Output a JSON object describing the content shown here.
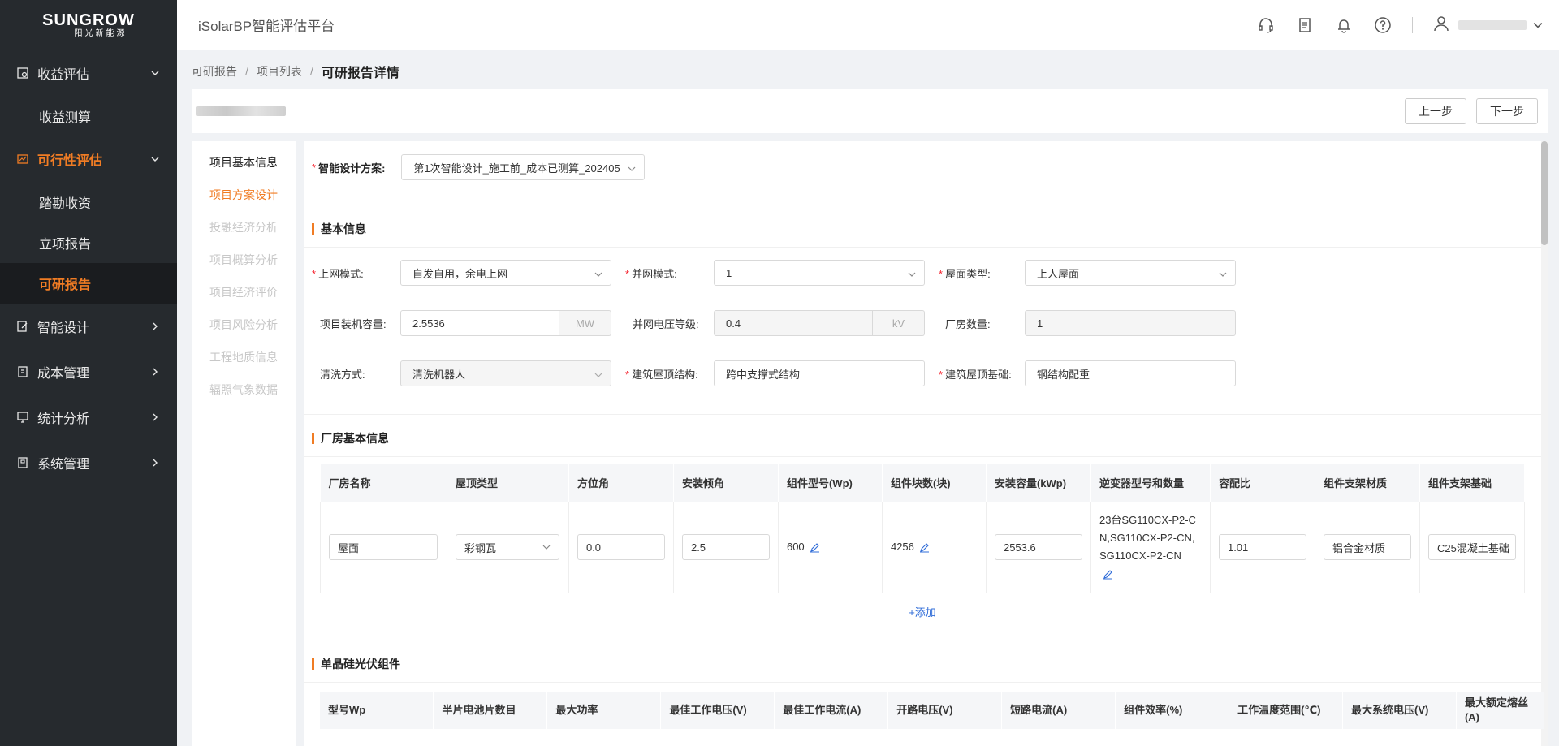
{
  "logo": {
    "brand": "SUNGROW",
    "sub": "阳光新能源"
  },
  "app_title": "iSolarBP智能评估平台",
  "sidebar": {
    "groups": [
      {
        "label": "收益评估",
        "expanded": true,
        "items": [
          "收益测算"
        ]
      },
      {
        "label": "可行性评估",
        "expanded": true,
        "active": true,
        "items": [
          "踏勘收资",
          "立项报告",
          "可研报告"
        ]
      },
      {
        "label": "智能设计"
      },
      {
        "label": "成本管理"
      },
      {
        "label": "统计分析"
      },
      {
        "label": "系统管理"
      }
    ]
  },
  "breadcrumb": {
    "items": [
      "可研报告",
      "项目列表"
    ],
    "current": "可研报告详情",
    "sep": "/"
  },
  "toolbar": {
    "prev_label": "上一步",
    "next_label": "下一步"
  },
  "steps": [
    "项目基本信息",
    "项目方案设计",
    "投融经济分析",
    "项目概算分析",
    "项目经济评价",
    "项目风险分析",
    "工程地质信息",
    "辐照气象数据"
  ],
  "design": {
    "label": "智能设计方案:",
    "value": "第1次智能设计_施工前_成本已测算_202405"
  },
  "basic": {
    "title": "基本信息",
    "grid_mode_label": "上网模式:",
    "grid_mode_value": "自发自用，余电上网",
    "parallel_label": "并网模式:",
    "parallel_value": "1",
    "roof_type_label": "屋面类型:",
    "roof_type_value": "上人屋面",
    "capacity_label": "项目装机容量:",
    "capacity_value": "2.5536",
    "capacity_unit": "MW",
    "voltage_label": "并网电压等级:",
    "voltage_value": "0.4",
    "voltage_unit": "kV",
    "plant_count_label": "厂房数量:",
    "plant_count_value": "1",
    "clean_label": "清洗方式:",
    "clean_value": "清洗机器人",
    "roof_struct_label": "建筑屋顶结构:",
    "roof_struct_value": "跨中支撑式结构",
    "roof_base_label": "建筑屋顶基础:",
    "roof_base_value": "钢结构配重"
  },
  "plant": {
    "title": "厂房基本信息",
    "columns": [
      "厂房名称",
      "屋顶类型",
      "方位角",
      "安装倾角",
      "组件型号(Wp)",
      "组件块数(块)",
      "安装容量(kWp)",
      "逆变器型号和数量",
      "容配比",
      "组件支架材质",
      "组件支架基础"
    ],
    "row": {
      "name": "屋面",
      "roof": "彩钢瓦",
      "azimuth": "0.0",
      "tilt": "2.5",
      "module": "600",
      "count": "4256",
      "capacity": "2553.6",
      "inverter": "23台SG110CX-P2-CN,SG110CX-P2-CN,SG110CX-P2-CN",
      "ratio": "1.01",
      "material": "铝合金材质",
      "foundation": "C25混凝土基础"
    },
    "add_label": "+添加"
  },
  "module": {
    "title": "单晶硅光伏组件",
    "columns": [
      "型号Wp",
      "半片电池片数目",
      "最大功率",
      "最佳工作电压(V)",
      "最佳工作电流(A)",
      "开路电压(V)",
      "短路电流(A)",
      "组件效率(%)",
      "工作温度范围(℃)",
      "最大系统电压(V)",
      "最大额定熔丝(A)"
    ]
  }
}
